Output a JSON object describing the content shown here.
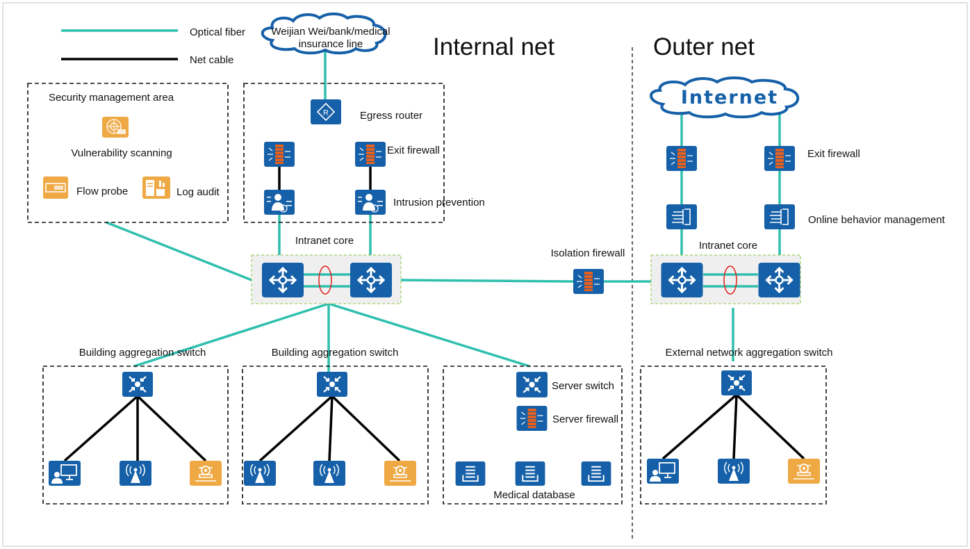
{
  "colors": {
    "device_blue": "#1560a8",
    "optical_fiber": "#2fbfae",
    "net_cable": "#000000",
    "security_orange": "#eea944",
    "lag_ring": "#e0201b"
  },
  "legend": [
    {
      "label": "Optical fiber",
      "line": "optical_fiber"
    },
    {
      "label": "Net cable",
      "line": "net_cable"
    }
  ],
  "zones": {
    "internal": "Internal net",
    "outer": "Outer net"
  },
  "clouds": {
    "private_line": [
      "Weijian Wei/bank/medical",
      "insurance line"
    ],
    "internet": "Internet"
  },
  "security_area": {
    "title": "Security management area",
    "vuln": "Vulnerability scanning",
    "probe": "Flow probe",
    "log": "Log audit"
  },
  "internal": {
    "egress_router": "Egress router",
    "exit_firewall": "Exit firewall",
    "intrusion_prevention": "Intrusion prevention",
    "intranet_core": "Intranet core",
    "isolation_firewall": "Isolation firewall",
    "building_agg_1": "Building aggregation switch",
    "building_agg_2": "Building aggregation switch",
    "server_switch": "Server switch",
    "server_firewall": "Server firewall",
    "medical_database": "Medical database"
  },
  "outer": {
    "exit_firewall": "Exit firewall",
    "online_behavior": "Online behavior management",
    "intranet_core": "Intranet core",
    "ext_agg": "External network aggregation switch"
  }
}
